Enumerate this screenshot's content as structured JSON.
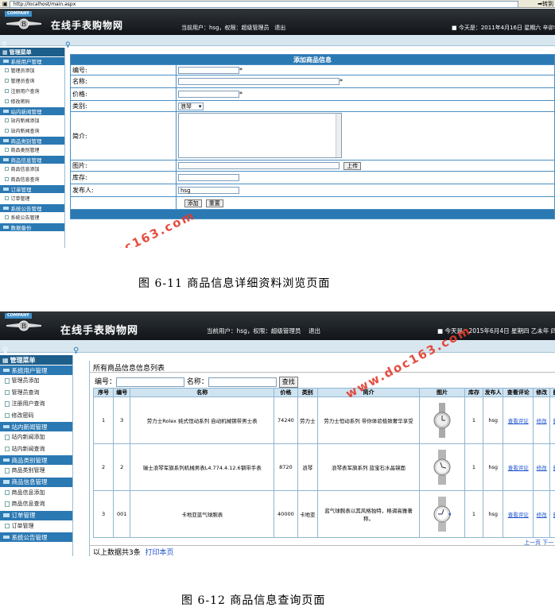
{
  "shot1": {
    "address": "http://localhost/main.aspx",
    "go_label": "转到",
    "banner": {
      "company": "COMPANY",
      "brand": "在线手表购物网",
      "user_info": "当前用户：hsg，权限：超级管理员",
      "logout": "退出",
      "date_info": "■ 今天是：2011年4月16日 星期六 辛卯年 三月"
    },
    "sidebar": {
      "head": "管理菜单",
      "groups": [
        {
          "title": "系统用户管理",
          "items": [
            "管理员添加",
            "管理员查询",
            "注册用户查询",
            "修改密码"
          ]
        },
        {
          "title": "站内新闻管理",
          "items": [
            "站内新闻添加",
            "站内新闻查询"
          ]
        },
        {
          "title": "商品类别管理",
          "items": [
            "商品类别管理"
          ]
        },
        {
          "title": "商品信息管理",
          "items": [
            "商品信息添加",
            "商品信息查询"
          ]
        },
        {
          "title": "订单管理",
          "items": [
            "订单管理"
          ]
        },
        {
          "title": "系统公告管理",
          "items": [
            "系统公告管理"
          ]
        },
        {
          "title": "数据备份",
          "items": []
        }
      ]
    },
    "form": {
      "title": "添加商品信息",
      "labels": {
        "code": "编号:",
        "name": "名称:",
        "price": "价格:",
        "category": "类别:",
        "intro": "简介:",
        "image": "图片:",
        "stock": "库存:",
        "publisher": "发布人:"
      },
      "required_mark": "*",
      "category_value": "浪琴",
      "upload_label": "上传",
      "publisher_value": "hsg",
      "add_label": "添加",
      "reset_label": "重置"
    },
    "watermark": "www.doc163.com"
  },
  "caption1": "图 6-11  商品信息详细资料浏览页面",
  "shot2": {
    "banner": {
      "company": "COMPANY",
      "brand": "在线手表购物网",
      "user_info": "当前用户：hsg，权限：超级管理员",
      "logout": "退出",
      "date_info": "■ 今天是：2015年6月4日 星期四 乙未年  四月"
    },
    "sidebar": {
      "head": "管理菜单",
      "groups": [
        {
          "title": "系统用户管理",
          "items": [
            "管理员添加",
            "管理员查询",
            "注册用户查询",
            "修改密码"
          ]
        },
        {
          "title": "站内新闻管理",
          "items": [
            "站内新闻添加",
            "站内新闻查询"
          ]
        },
        {
          "title": "商品类别管理",
          "items": [
            "商品类别管理"
          ]
        },
        {
          "title": "商品信息管理",
          "items": [
            "商品信息添加",
            "商品信息查询"
          ]
        },
        {
          "title": "订单管理",
          "items": [
            "订单管理"
          ]
        },
        {
          "title": "系统公告管理",
          "items": []
        }
      ]
    },
    "list": {
      "title": "所有商品信息信息列表",
      "code_label": "编号：",
      "name_label": "名称：",
      "search_label": "查找",
      "columns": [
        "序号",
        "编号",
        "名称",
        "价格",
        "类别",
        "简介",
        "图片",
        "库存",
        "发布人",
        "查看评论",
        "修改",
        "删"
      ],
      "rows": [
        {
          "seq": "1",
          "code": "3",
          "name": "劳力士Rolex 蚝式恒动系列 自动机械钢带男士表",
          "price": "74240",
          "category": "劳力士",
          "intro": "劳力士恒动系列 带你体验极致奢华享受",
          "stock": "1",
          "publisher": "hsg",
          "view": "查看评论",
          "edit": "修改",
          "del": "删"
        },
        {
          "seq": "2",
          "code": "2",
          "name": "瑞士浪琴军旗系列机械男表L4.774.4.12.6钢带手表",
          "price": "8720",
          "category": "浪琴",
          "intro": "浪琴表军旗系列 蓝宝石水晶镜面",
          "stock": "1",
          "publisher": "hsg",
          "view": "查看评论",
          "edit": "修改",
          "del": "删"
        },
        {
          "seq": "3",
          "code": "001",
          "name": "卡地亚蓝气球腕表",
          "price": "40000",
          "category": "卡地亚",
          "intro": "蓝气球腕表以其风格独特，格调高雅著称。",
          "stock": "1",
          "publisher": "hsg",
          "view": "查看评论",
          "edit": "修改",
          "del": "删"
        }
      ],
      "pager": "上一页  下一",
      "footer_text": "以上数据共3条",
      "print_label": "打印本页"
    },
    "watermark": "www.doc163.com"
  },
  "caption2": "图 6-12  商品信息查询页面",
  "colors": {
    "banner": "#1a1f25",
    "sidebar_group": "#2b79b3",
    "table_header": "#2b79b3",
    "watermark": "#e43a2c"
  }
}
